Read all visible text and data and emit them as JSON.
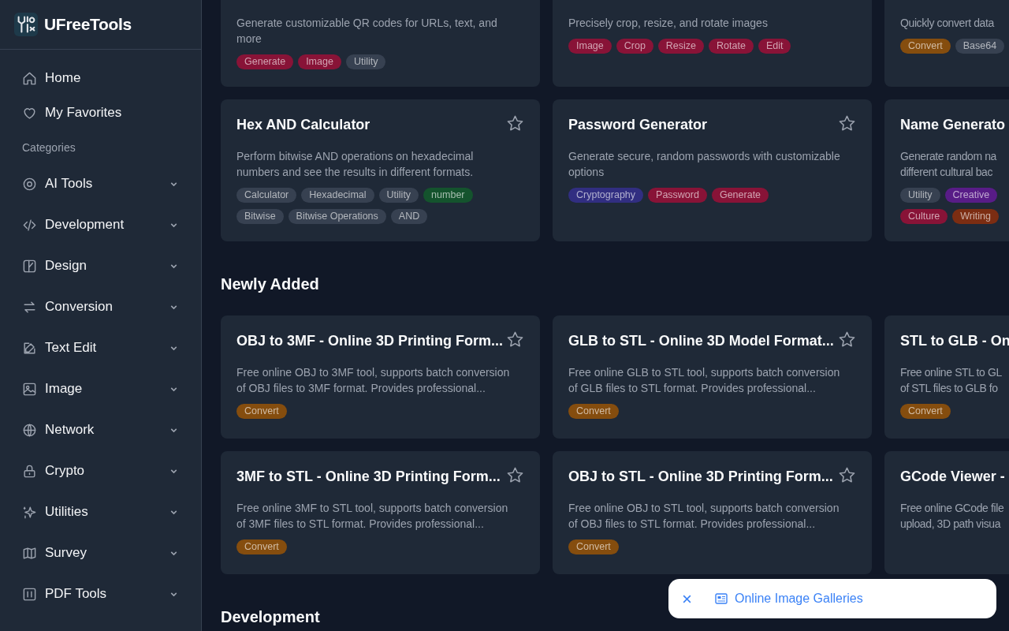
{
  "brand": {
    "name": "UFreeTools"
  },
  "nav": [
    {
      "label": "Home"
    },
    {
      "label": "My Favorites"
    }
  ],
  "categories_heading": "Categories",
  "categories": [
    {
      "label": "AI Tools",
      "expanded": false
    },
    {
      "label": "Development",
      "expanded": false
    },
    {
      "label": "Design",
      "expanded": false
    },
    {
      "label": "Conversion",
      "expanded": false
    },
    {
      "label": "Text Edit",
      "expanded": false
    },
    {
      "label": "Image",
      "expanded": false
    },
    {
      "label": "Network",
      "expanded": false
    },
    {
      "label": "Crypto",
      "expanded": false
    },
    {
      "label": "Utilities",
      "expanded": false
    },
    {
      "label": "Survey",
      "expanded": false
    },
    {
      "label": "PDF Tools",
      "expanded": false
    }
  ],
  "sections": [
    {
      "cards": [
        {
          "description": [
            "Generate customizable QR codes for URLs, text, and",
            "more"
          ],
          "tags": [
            {
              "label": "Generate",
              "color": "#881337"
            },
            {
              "label": "Image",
              "color": "#881337"
            },
            {
              "label": "Utility",
              "color": "#374151"
            }
          ]
        },
        {
          "description": [
            "Precisely crop, resize, and rotate images"
          ],
          "tags": [
            {
              "label": "Image",
              "color": "#881337"
            },
            {
              "label": "Crop",
              "color": "#881337"
            },
            {
              "label": "Resize",
              "color": "#881337"
            },
            {
              "label": "Rotate",
              "color": "#881337"
            },
            {
              "label": "Edit",
              "color": "#881337"
            }
          ]
        },
        {
          "description": [
            "Quickly convert data"
          ],
          "tags": [
            {
              "label": "Convert",
              "color": "#854d0e"
            },
            {
              "label": "Base64",
              "color": "#374151"
            }
          ]
        },
        {
          "title": "Hex AND Calculator",
          "favorite": false,
          "description": [
            "Perform bitwise AND operations on hexadecimal",
            "numbers and see the results in different formats."
          ],
          "tags": [
            {
              "label": "Calculator",
              "color": "#374151"
            },
            {
              "label": "Hexadecimal",
              "color": "#374151"
            },
            {
              "label": "Utility",
              "color": "#374151"
            },
            {
              "label": "number",
              "color": "#14532d"
            },
            {
              "label": "Bitwise",
              "color": "#374151"
            },
            {
              "label": "Bitwise Operations",
              "color": "#374151"
            },
            {
              "label": "AND",
              "color": "#374151"
            }
          ]
        },
        {
          "title": "Password Generator",
          "favorite": false,
          "description": [
            "Generate secure, random passwords with customizable",
            "options"
          ],
          "tags": [
            {
              "label": "Cryptography",
              "color": "#312e81"
            },
            {
              "label": "Password",
              "color": "#881337"
            },
            {
              "label": "Generate",
              "color": "#881337"
            }
          ]
        },
        {
          "title": "Name Generato",
          "description": [
            "Generate random na",
            "different cultural bac"
          ],
          "tags": [
            {
              "label": "Utility",
              "color": "#374151"
            },
            {
              "label": "Creative",
              "color": "#581c87"
            },
            {
              "label": "Culture",
              "color": "#881337"
            },
            {
              "label": "Writing",
              "color": "#7c2d12"
            }
          ]
        }
      ]
    },
    {
      "heading": "Newly Added",
      "cards": [
        {
          "title": "OBJ to 3MF - Online 3D Printing Form...",
          "favorite": false,
          "description": [
            "Free online OBJ to 3MF tool, supports batch conversion",
            "of OBJ files to 3MF format. Provides professional..."
          ],
          "tags": [
            {
              "label": "Convert",
              "color": "#854d0e"
            }
          ]
        },
        {
          "title": "GLB to STL - Online 3D Model Format...",
          "favorite": false,
          "description": [
            "Free online GLB to STL tool, supports batch conversion",
            "of GLB files to STL format. Provides professional..."
          ],
          "tags": [
            {
              "label": "Convert",
              "color": "#854d0e"
            }
          ]
        },
        {
          "title": "STL to GLB - On",
          "description": [
            "Free online STL to GL",
            "of STL files to GLB fo"
          ],
          "tags": [
            {
              "label": "Convert",
              "color": "#854d0e"
            }
          ]
        },
        {
          "title": "3MF to STL - Online 3D Printing Form...",
          "favorite": false,
          "description": [
            "Free online 3MF to STL tool, supports batch conversion",
            "of 3MF files to STL format. Provides professional..."
          ],
          "tags": [
            {
              "label": "Convert",
              "color": "#854d0e"
            }
          ]
        },
        {
          "title": "OBJ to STL - Online 3D Printing Form...",
          "favorite": false,
          "description": [
            "Free online OBJ to STL tool, supports batch conversion",
            "of OBJ files to STL format. Provides professional..."
          ],
          "tags": [
            {
              "label": "Convert",
              "color": "#854d0e"
            }
          ]
        },
        {
          "title": "GCode Viewer -",
          "description": [
            "Free online GCode file",
            "upload, 3D path visua"
          ]
        }
      ]
    },
    {
      "heading": "Development"
    }
  ],
  "popup": {
    "link": "Online Image Galleries"
  }
}
